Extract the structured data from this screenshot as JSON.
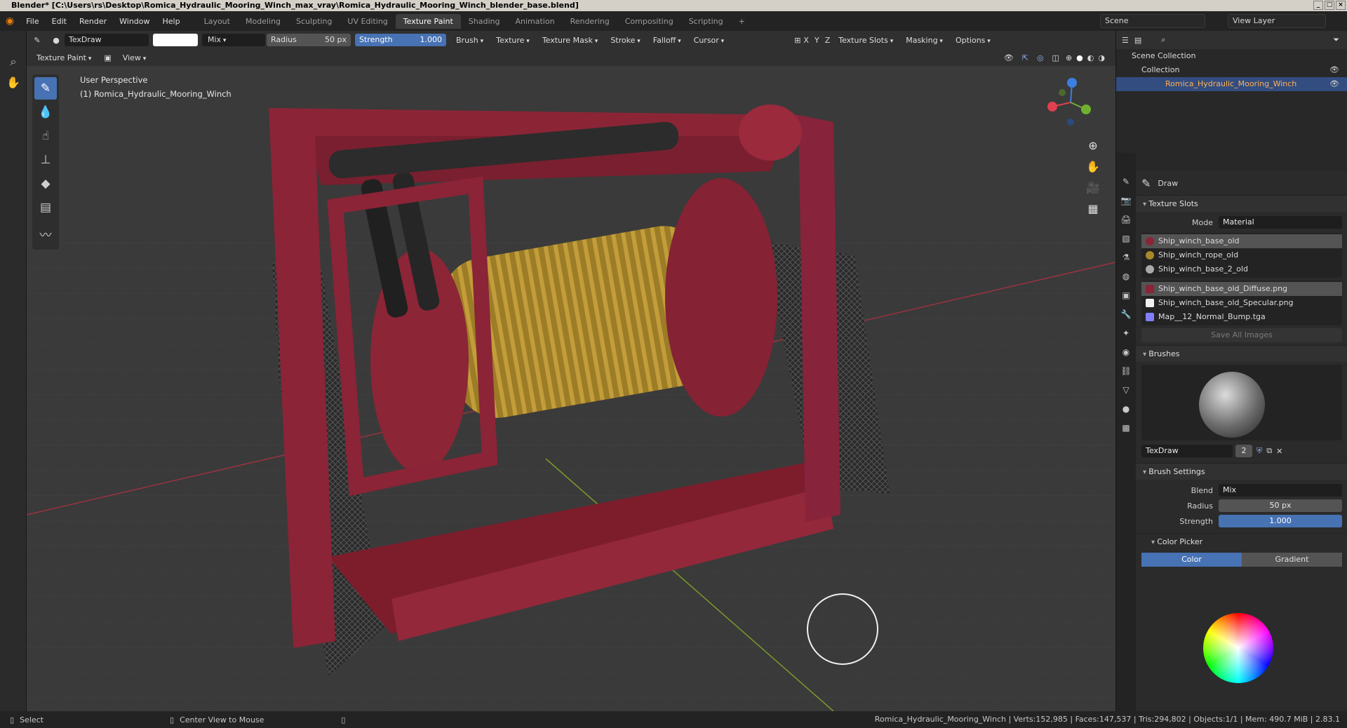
{
  "window": {
    "title": "Blender* [C:\\Users\\rs\\Desktop\\Romica_Hydraulic_Mooring_Winch_max_vray\\Romica_Hydraulic_Mooring_Winch_blender_base.blend]"
  },
  "menus": [
    "File",
    "Edit",
    "Render",
    "Window",
    "Help"
  ],
  "workspaces": [
    "Layout",
    "Modeling",
    "Sculpting",
    "UV Editing",
    "Texture Paint",
    "Shading",
    "Animation",
    "Rendering",
    "Compositing",
    "Scripting"
  ],
  "active_workspace": "Texture Paint",
  "scene": "Scene",
  "view_layer": "View Layer",
  "toolheader": {
    "brush_name": "TexDraw",
    "blend": "Mix",
    "radius_label": "Radius",
    "radius_value": "50 px",
    "strength_label": "Strength",
    "strength_value": "1.000",
    "dropdowns": [
      "Brush",
      "Texture",
      "Texture Mask",
      "Stroke",
      "Falloff",
      "Cursor"
    ],
    "axes": [
      "X",
      "Y",
      "Z"
    ],
    "right_dropdowns": [
      "Texture Slots",
      "Masking",
      "Options"
    ]
  },
  "viewport_header": {
    "mode": "Texture Paint",
    "view": "View"
  },
  "viewport": {
    "perspective": "User Perspective",
    "object_label": "(1) Romica_Hydraulic_Mooring_Winch"
  },
  "outliner": {
    "scene_collection": "Scene Collection",
    "collection": "Collection",
    "object": "Romica_Hydraulic_Mooring_Winch"
  },
  "properties": {
    "tool_name": "Draw",
    "texture_slots": {
      "title": "Texture Slots",
      "mode_label": "Mode",
      "mode_value": "Material",
      "materials": [
        "Ship_winch_base_old",
        "Ship_winch_rope_old",
        "Ship_winch_base_2_old"
      ],
      "images": [
        "Ship_winch_base_old_Diffuse.png",
        "Ship_winch_base_old_Specular.png",
        "Map__12_Normal_Bump.tga"
      ],
      "save_all": "Save All Images"
    },
    "brushes": {
      "title": "Brushes",
      "brush_name": "TexDraw",
      "users": "2"
    },
    "brush_settings": {
      "title": "Brush Settings",
      "blend_label": "Blend",
      "blend_value": "Mix",
      "radius_label": "Radius",
      "radius_value": "50 px",
      "strength_label": "Strength",
      "strength_value": "1.000"
    },
    "color_picker": {
      "title": "Color Picker",
      "color_tab": "Color",
      "gradient_tab": "Gradient"
    }
  },
  "statusbar": {
    "select": "Select",
    "center": "Center View to Mouse",
    "stats": "Romica_Hydraulic_Mooring_Winch | Verts:152,985 | Faces:147,537 | Tris:294,802 | Objects:1/1 | Mem: 490.7 MiB | 2.83.1"
  },
  "colors": {
    "accent": "#4772b3",
    "winch_red": "#8a2233",
    "rope": "#a8882a",
    "bg": "#3a3a3a"
  }
}
